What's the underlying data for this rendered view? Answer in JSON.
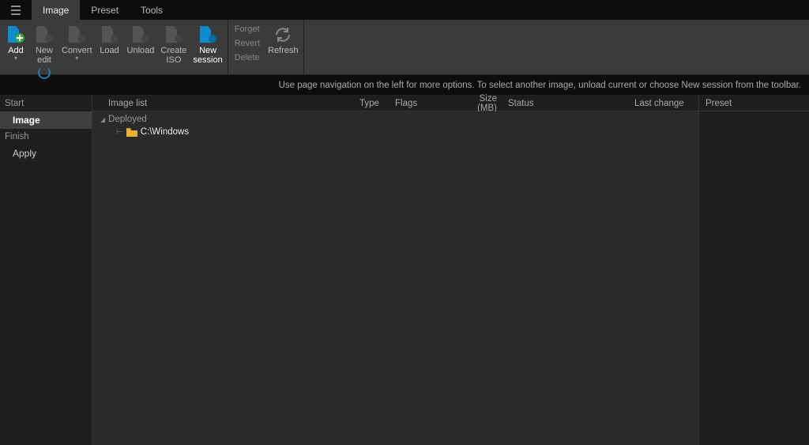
{
  "tabs": {
    "image": "Image",
    "preset": "Preset",
    "tools": "Tools"
  },
  "ribbon": {
    "add": "Add",
    "new_edit_l1": "New",
    "new_edit_l2": "edit",
    "convert": "Convert",
    "load": "Load",
    "unload": "Unload",
    "create_iso_l1": "Create",
    "create_iso_l2": "ISO",
    "new_session_l1": "New",
    "new_session_l2": "session",
    "forget": "Forget",
    "revert": "Revert",
    "delete": "Delete",
    "refresh": "Refresh"
  },
  "infobar": "Use page navigation on the left for more options. To select another image, unload current or choose New session from the toolbar.",
  "sidebar": {
    "start_header": "Start",
    "image": "Image",
    "finish_header": "Finish",
    "apply": "Apply"
  },
  "columns": {
    "imagelist": "Image list",
    "type": "Type",
    "flags": "Flags",
    "size": "Size (MB)",
    "status": "Status",
    "lastchange": "Last change"
  },
  "list": {
    "group": "Deployed",
    "item_path": "C:\\Windows"
  },
  "rightpanel": {
    "header": "Preset"
  }
}
